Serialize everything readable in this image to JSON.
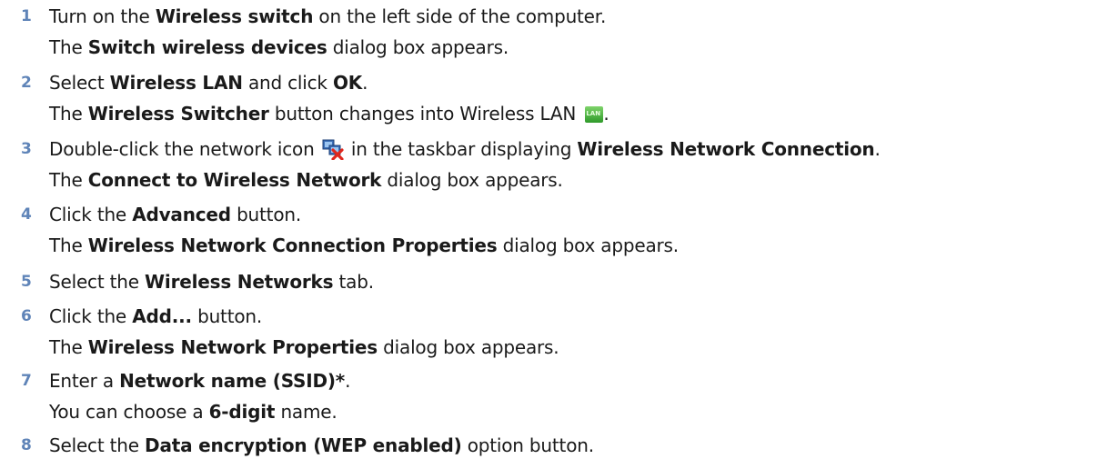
{
  "steps": [
    {
      "number": "1",
      "line1": [
        "Turn on the ",
        "Wireless switch",
        " on the left side of the computer."
      ],
      "line2": [
        "The ",
        "Switch wireless devices",
        " dialog box appears."
      ]
    },
    {
      "number": "2",
      "line1": [
        "Select ",
        "Wireless LAN",
        " and click ",
        "OK",
        "."
      ],
      "line2": [
        "The ",
        "Wireless Switcher",
        " button changes into Wireless LAN ",
        "."
      ]
    },
    {
      "number": "3",
      "line1": [
        "Double-click the network icon ",
        " in the taskbar displaying ",
        "Wireless Network Connection",
        "."
      ],
      "line2": [
        "The ",
        "Connect to Wireless Network",
        " dialog box appears."
      ]
    },
    {
      "number": "4",
      "line1": [
        "Click the ",
        "Advanced",
        " button."
      ],
      "line2": [
        "The ",
        "Wireless Network Connection Properties",
        " dialog box appears."
      ]
    },
    {
      "number": "5",
      "line1": [
        "Select the ",
        "Wireless Networks",
        " tab."
      ]
    },
    {
      "number": "6",
      "line1": [
        "Click the ",
        "Add...",
        " button."
      ],
      "line2": [
        "The ",
        "Wireless Network Properties",
        " dialog box appears."
      ]
    },
    {
      "number": "7",
      "line1": [
        "Enter a ",
        "Network name (SSID)*",
        "."
      ],
      "line2": [
        "You can choose a ",
        "6-digit",
        " name."
      ]
    },
    {
      "number": "8",
      "line1": [
        "Select the ",
        "Data encryption (WEP enabled)",
        " option button."
      ]
    }
  ],
  "icons": {
    "lan_icon_text": "LAN",
    "network_icon": "network-error-icon"
  },
  "colors": {
    "step_number": "#5f84b8",
    "text": "#1a1a1a"
  }
}
